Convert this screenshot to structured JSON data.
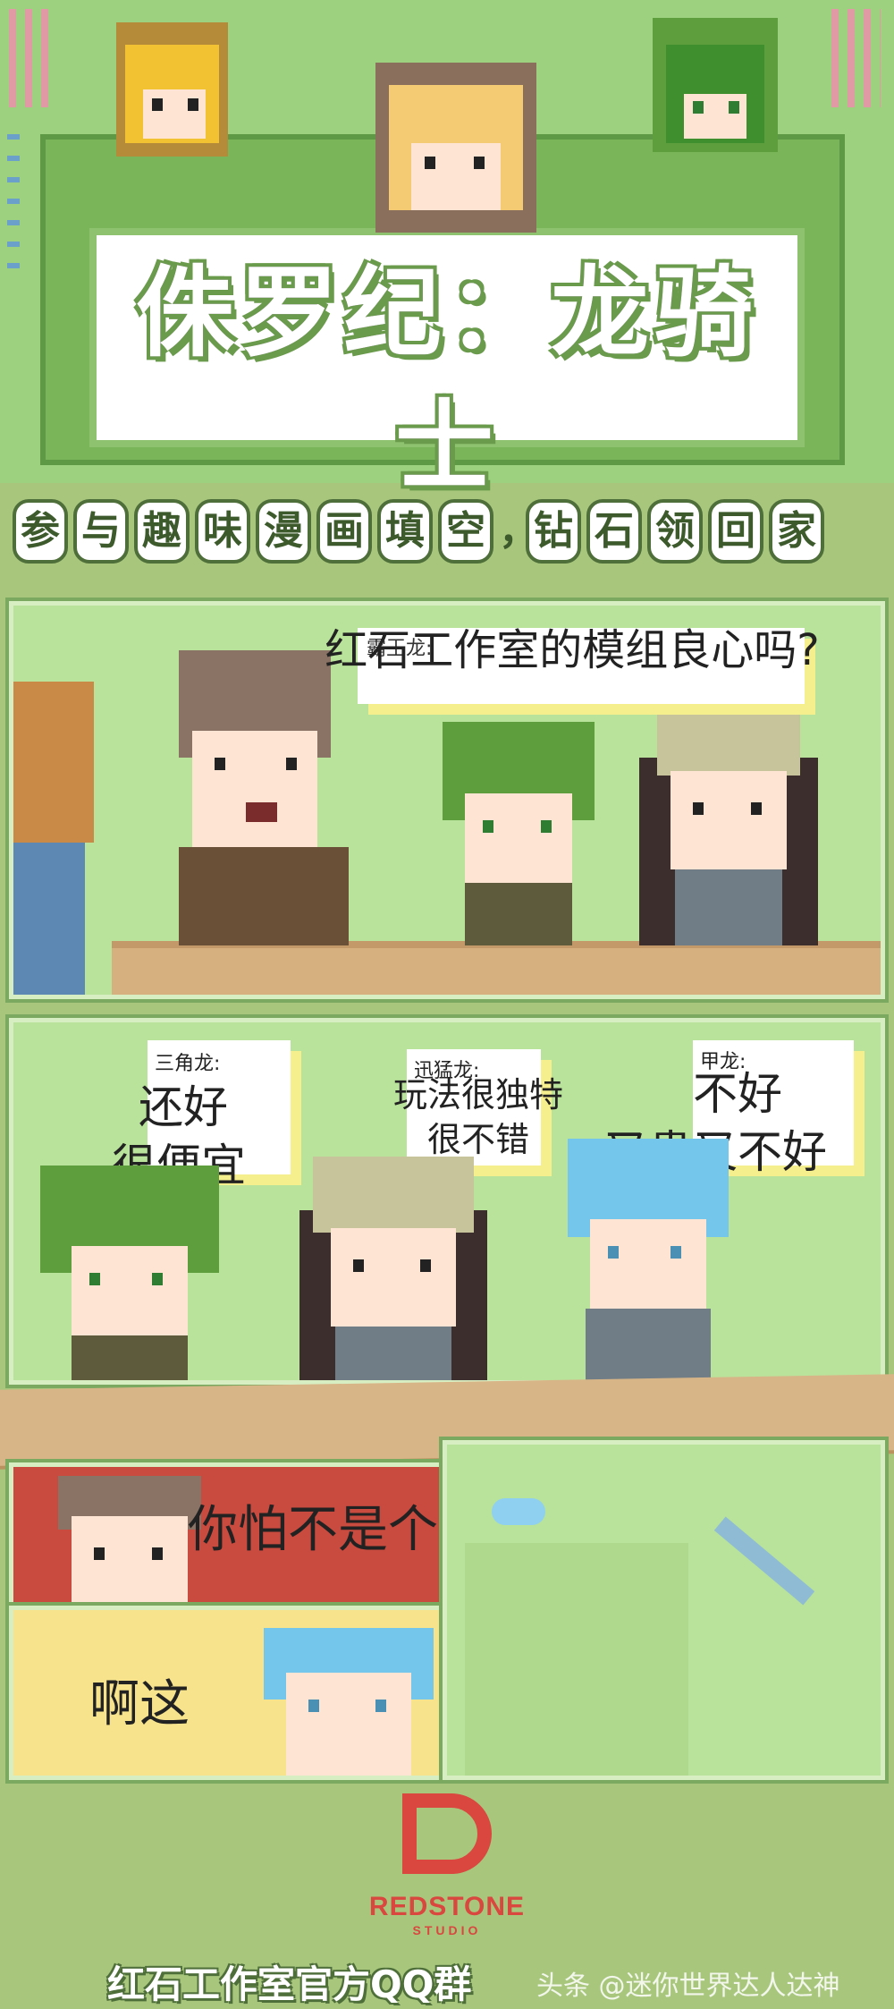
{
  "header": {
    "title": "侏罗纪：龙骑士",
    "subtitle_chars": [
      "参",
      "与",
      "趣",
      "味",
      "漫",
      "画",
      "填",
      "空",
      "，",
      "钻",
      "石",
      "领",
      "回",
      "家"
    ]
  },
  "panel1": {
    "speaker_tag": "霸王龙:",
    "speech": "红石工作室的模组良心吗?"
  },
  "panel2": {
    "bubble1_tag": "三角龙:",
    "bubble1_line1": "还好",
    "bubble1_line2": "很便宜",
    "bubble2_tag": "迅猛龙:",
    "bubble2_line1": "玩法很独特",
    "bubble2_line2": "很不错",
    "bubble3_tag": "甲龙:",
    "bubble3_line1": "不好",
    "bubble3_line2": "又贵又不好"
  },
  "panel3": {
    "speech": "你怕不是个"
  },
  "panel4": {
    "speech": "啊这"
  },
  "footer": {
    "logo_text": "REDSTONE",
    "logo_sub": "STUDIO",
    "group_label": "红石工作室官方QQ群",
    "watermark": "头条 @迷你世界达人达神"
  },
  "colors": {
    "background": "#a8c77d",
    "panel_green": "#b9e39a",
    "accent_red": "#d9473f",
    "bubble_shadow": "#f6ef8e"
  }
}
